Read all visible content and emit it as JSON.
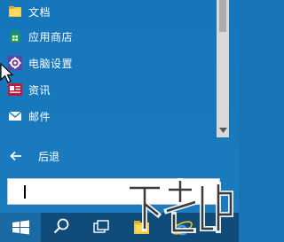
{
  "menu": {
    "items": [
      {
        "label": "文档",
        "icon": "folder-icon"
      },
      {
        "label": "应用商店",
        "icon": "store-icon"
      },
      {
        "label": "电脑设置",
        "icon": "gear-icon"
      },
      {
        "label": "资讯",
        "icon": "news-icon"
      },
      {
        "label": "邮件",
        "icon": "mail-icon"
      }
    ]
  },
  "back": {
    "label": "后退",
    "icon": "back-arrow-icon"
  },
  "search": {
    "value": ""
  },
  "taskbar": {
    "buttons": [
      "windows-logo-icon",
      "search-icon",
      "task-view-icon",
      "file-explorer-icon",
      "internet-explorer-icon"
    ]
  },
  "colors": {
    "panel": "#1576bb",
    "taskbar": "#0f4c79",
    "scrollbar_track": "#d9d9d9",
    "scrollbar_thumb": "#ababab"
  },
  "watermark": {
    "icon": "watermark-logo-icon"
  }
}
